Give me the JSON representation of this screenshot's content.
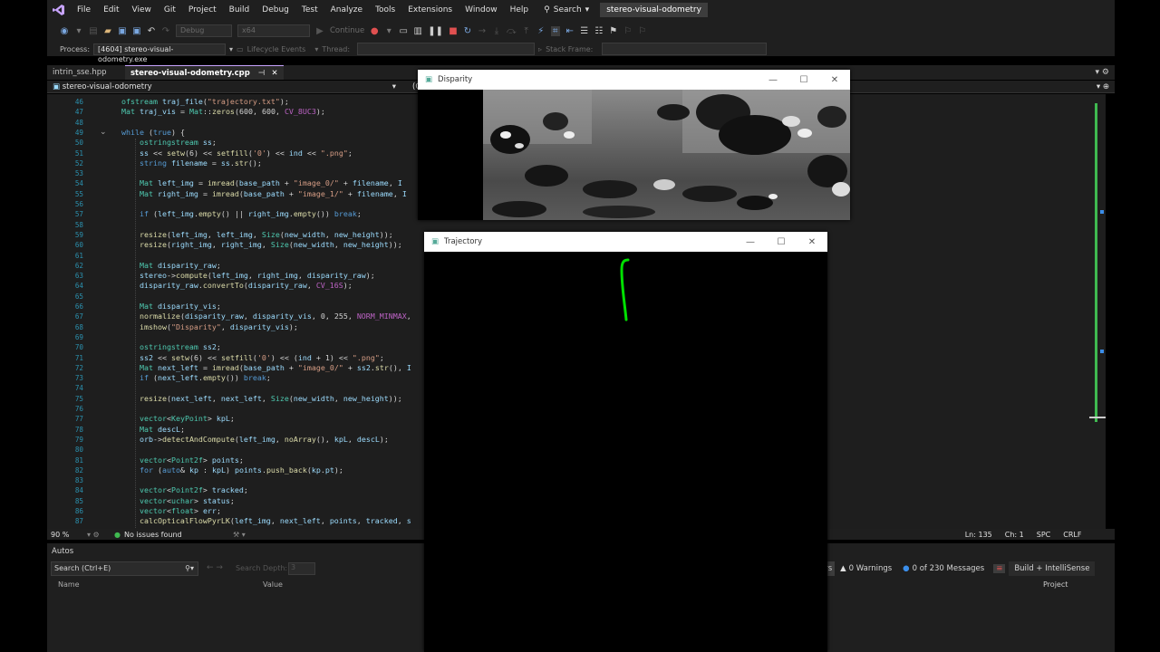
{
  "menubar": {
    "items": [
      "File",
      "Edit",
      "View",
      "Git",
      "Project",
      "Build",
      "Debug",
      "Test",
      "Analyze",
      "Tools",
      "Extensions",
      "Window",
      "Help"
    ],
    "search_label": "Search",
    "solution_name": "stereo-visual-odometry"
  },
  "toolbar": {
    "config": "Debug",
    "platform": "x64",
    "continue_label": "Continue"
  },
  "processbar": {
    "process_label": "Process:",
    "process_value": "[4604] stereo-visual-odometry.exe",
    "lifecycle_label": "Lifecycle Events",
    "thread_label": "Thread:",
    "stackframe_label": "Stack Frame:"
  },
  "tabs": [
    {
      "label": "intrin_sse.hpp"
    },
    {
      "label": "stereo-visual-odometry.cpp",
      "pin": "⊣",
      "close": "✕"
    }
  ],
  "navbar": {
    "scope": "stereo-visual-odometry",
    "right_label": "(C"
  },
  "code_lines": [
    {
      "n": "46",
      "t": "    ofstream traj_file(\"trajectory.txt\");"
    },
    {
      "n": "47",
      "t": "    Mat traj_vis = Mat::zeros(600, 600, CV_8UC3);"
    },
    {
      "n": "48",
      "t": ""
    },
    {
      "n": "49",
      "t": "    while (true) {"
    },
    {
      "n": "50",
      "t": "        ostringstream ss;"
    },
    {
      "n": "51",
      "t": "        ss << setw(6) << setfill('0') << ind << \".png\";"
    },
    {
      "n": "52",
      "t": "        string filename = ss.str();"
    },
    {
      "n": "53",
      "t": ""
    },
    {
      "n": "54",
      "t": "        Mat left_img = imread(base_path + \"image_0/\" + filename, I"
    },
    {
      "n": "55",
      "t": "        Mat right_img = imread(base_path + \"image_1/\" + filename, I"
    },
    {
      "n": "56",
      "t": ""
    },
    {
      "n": "57",
      "t": "        if (left_img.empty() || right_img.empty()) break;"
    },
    {
      "n": "58",
      "t": ""
    },
    {
      "n": "59",
      "t": "        resize(left_img, left_img, Size(new_width, new_height));"
    },
    {
      "n": "60",
      "t": "        resize(right_img, right_img, Size(new_width, new_height));"
    },
    {
      "n": "61",
      "t": ""
    },
    {
      "n": "62",
      "t": "        Mat disparity_raw;"
    },
    {
      "n": "63",
      "t": "        stereo->compute(left_img, right_img, disparity_raw);"
    },
    {
      "n": "64",
      "t": "        disparity_raw.convertTo(disparity_raw, CV_16S);"
    },
    {
      "n": "65",
      "t": ""
    },
    {
      "n": "66",
      "t": "        Mat disparity_vis;"
    },
    {
      "n": "67",
      "t": "        normalize(disparity_raw, disparity_vis, 0, 255, NORM_MINMAX,"
    },
    {
      "n": "68",
      "t": "        imshow(\"Disparity\", disparity_vis);"
    },
    {
      "n": "69",
      "t": ""
    },
    {
      "n": "70",
      "t": "        ostringstream ss2;"
    },
    {
      "n": "71",
      "t": "        ss2 << setw(6) << setfill('0') << (ind + 1) << \".png\";"
    },
    {
      "n": "72",
      "t": "        Mat next_left = imread(base_path + \"image_0/\" + ss2.str(), I"
    },
    {
      "n": "73",
      "t": "        if (next_left.empty()) break;"
    },
    {
      "n": "74",
      "t": ""
    },
    {
      "n": "75",
      "t": "        resize(next_left, next_left, Size(new_width, new_height));"
    },
    {
      "n": "76",
      "t": ""
    },
    {
      "n": "77",
      "t": "        vector<KeyPoint> kpL;"
    },
    {
      "n": "78",
      "t": "        Mat descL;"
    },
    {
      "n": "79",
      "t": "        orb->detectAndCompute(left_img, noArray(), kpL, descL);"
    },
    {
      "n": "80",
      "t": ""
    },
    {
      "n": "81",
      "t": "        vector<Point2f> points;"
    },
    {
      "n": "82",
      "t": "        for (auto& kp : kpL) points.push_back(kp.pt);"
    },
    {
      "n": "83",
      "t": ""
    },
    {
      "n": "84",
      "t": "        vector<Point2f> tracked;"
    },
    {
      "n": "85",
      "t": "        vector<uchar> status;"
    },
    {
      "n": "86",
      "t": "        vector<float> err;"
    },
    {
      "n": "87",
      "t": "        calcOpticalFlowPyrLK(left_img, next_left, points, tracked, s"
    }
  ],
  "status": {
    "zoom": "90 %",
    "issues": "No issues found",
    "ln": "Ln: 135",
    "ch": "Ch: 1",
    "spc": "SPC",
    "crlf": "CRLF"
  },
  "autos": {
    "title": "Autos",
    "search_placeholder": "Search (Ctrl+E)",
    "search_depth_label": "Search Depth:",
    "search_depth_value": "3",
    "col_name": "Name",
    "col_value": "Value"
  },
  "errorlist": {
    "errors_tail": "ors",
    "warnings": "0 Warnings",
    "messages": "0 of 230 Messages",
    "filter": "Build + IntelliSense",
    "col_project": "Project"
  },
  "windows": {
    "disparity_title": "Disparity",
    "trajectory_title": "Trajectory"
  },
  "colors": {
    "keyword": "#569cd6",
    "type": "#4ec9b0",
    "string": "#d69d85",
    "function": "#dcdcaa",
    "variable": "#9cdcfe",
    "plain": "#d4d4d4",
    "trajectory": "#00e000",
    "accent": "#c8a4ff"
  }
}
